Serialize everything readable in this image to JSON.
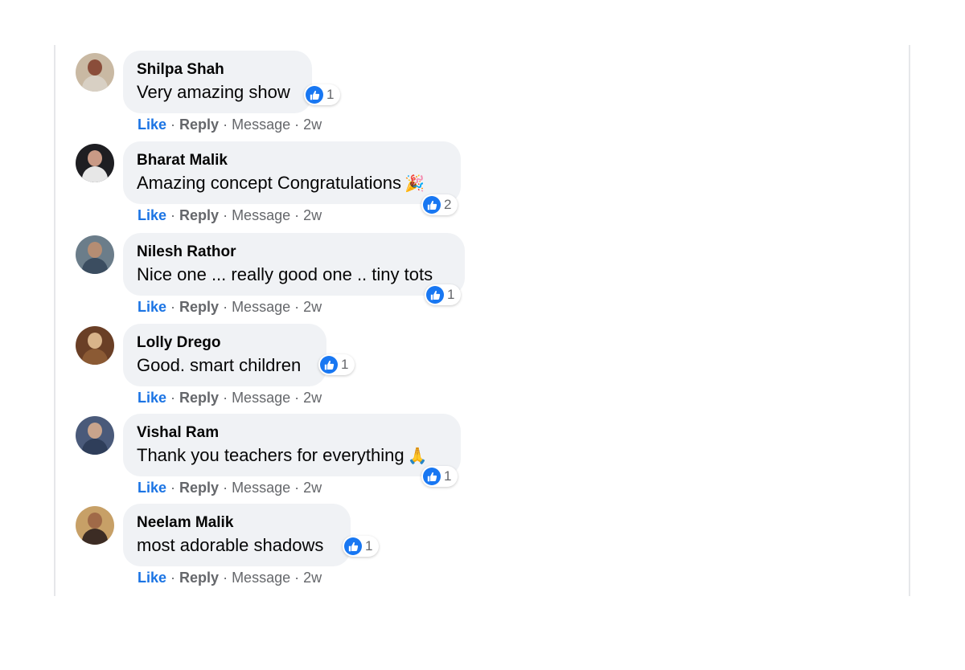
{
  "comments": [
    {
      "author": "Shilpa Shah",
      "text": "Very amazing show",
      "emoji": "",
      "reactions": "1",
      "time": "2w",
      "avatar_colors": [
        "#c9b9a3",
        "#8a4d3a",
        "#d8d0c4"
      ]
    },
    {
      "author": "Bharat Malik",
      "text": "Amazing concept Congratulations",
      "emoji": "🎉",
      "reactions": "2",
      "time": "2w",
      "avatar_colors": [
        "#1e1e22",
        "#c99a86",
        "#e7e7e7"
      ]
    },
    {
      "author": "Nilesh Rathor",
      "text": "Nice one ... really good one .. tiny tots",
      "emoji": "",
      "reactions": "1",
      "time": "2w",
      "avatar_colors": [
        "#6b7d8a",
        "#b58d73",
        "#3b4d60"
      ]
    },
    {
      "author": "Lolly Drego",
      "text": "Good. smart children",
      "emoji": "",
      "reactions": "1",
      "time": "2w",
      "avatar_colors": [
        "#6a3f26",
        "#d9b48a",
        "#8b5a34"
      ]
    },
    {
      "author": "Vishal Ram",
      "text": "Thank you teachers for everything",
      "emoji": "🙏",
      "reactions": "1",
      "time": "2w",
      "avatar_colors": [
        "#4a5a7a",
        "#c9a48c",
        "#2f3e5a"
      ]
    },
    {
      "author": "Neelam Malik",
      "text": "most adorable shadows",
      "emoji": "",
      "reactions": "1",
      "time": "2w",
      "avatar_colors": [
        "#c7a067",
        "#a06a48",
        "#3c2c24"
      ]
    }
  ],
  "actions": {
    "like": "Like",
    "reply": "Reply",
    "message": "Message",
    "separator": "·"
  },
  "colors": {
    "like_blue": "#1877f2",
    "link_blue": "#1b74e4",
    "bubble_bg": "#f0f2f5",
    "meta_gray": "#65676b"
  }
}
